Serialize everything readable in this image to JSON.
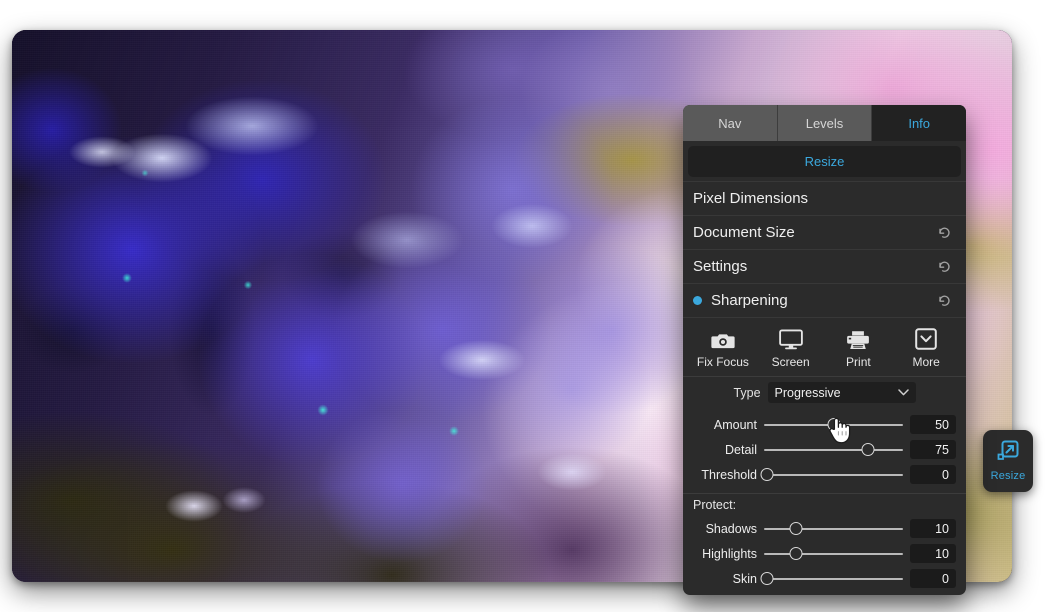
{
  "app": {
    "photo_alt": "Blue hydrangea flowers macro photograph with pink and olive bokeh background"
  },
  "resize_tab": {
    "label": "Resize",
    "icon": "resize-arrow-icon",
    "accent": "#3ba8dd"
  },
  "panel": {
    "tabs": [
      {
        "label": "Nav",
        "active": false
      },
      {
        "label": "Levels",
        "active": false
      },
      {
        "label": "Info",
        "active": true
      }
    ],
    "resize_button": {
      "label": "Resize"
    },
    "sections": [
      {
        "label": "Pixel Dimensions",
        "has_dot": false,
        "has_revert": false
      },
      {
        "label": "Document Size",
        "has_dot": false,
        "has_revert": true
      },
      {
        "label": "Settings",
        "has_dot": false,
        "has_revert": true
      },
      {
        "label": "Sharpening",
        "has_dot": true,
        "has_revert": true
      }
    ],
    "icon_buttons": [
      {
        "label": "Fix Focus",
        "icon": "camera-icon"
      },
      {
        "label": "Screen",
        "icon": "monitor-icon"
      },
      {
        "label": "Print",
        "icon": "printer-icon"
      },
      {
        "label": "More",
        "icon": "chevron-down-box-icon"
      }
    ],
    "type_row": {
      "label": "Type",
      "value": "Progressive",
      "chevron": "chevron-down-icon"
    },
    "sharpen_sliders": [
      {
        "label": "Amount",
        "value": "50",
        "percent": 50
      },
      {
        "label": "Detail",
        "value": "75",
        "percent": 75
      },
      {
        "label": "Threshold",
        "value": "0",
        "percent": 0
      }
    ],
    "protect": {
      "label": "Protect:",
      "sliders": [
        {
          "label": "Shadows",
          "value": "10",
          "percent": 23
        },
        {
          "label": "Highlights",
          "value": "10",
          "percent": 23
        },
        {
          "label": "Skin",
          "value": "0",
          "percent": 0
        }
      ]
    }
  },
  "cursor": {
    "type": "pointing-hand"
  }
}
